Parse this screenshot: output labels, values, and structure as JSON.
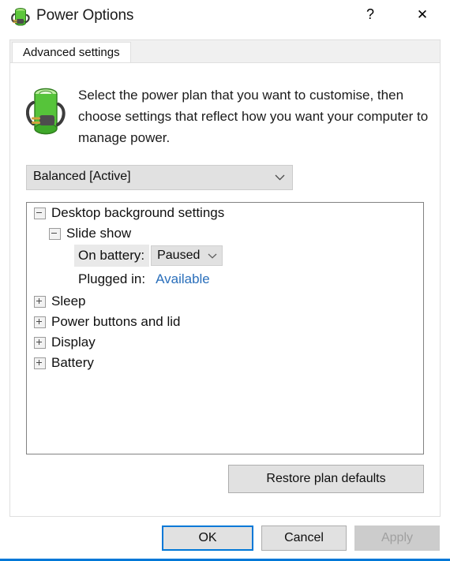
{
  "window": {
    "title": "Power Options",
    "icon": "power-plan-battery-plug-icon",
    "help_label": "?",
    "close_label": "✕",
    "accent_color": "#0078d7"
  },
  "tabs": [
    {
      "label": "Advanced settings",
      "selected": true
    }
  ],
  "header": {
    "icon": "battery-with-power-plug-icon",
    "description": "Select the power plan that you want to customise, then choose settings that reflect how you want your computer to manage power."
  },
  "plan_selector": {
    "name": "power-plan-dropdown",
    "selected": "Balanced [Active]",
    "arrow": "chevron-down-icon"
  },
  "settings_tree": {
    "nodes": [
      {
        "label": "Desktop background settings",
        "level": 0,
        "expanded": true,
        "expander": "collapse-minus-icon"
      },
      {
        "label": "Slide show",
        "level": 1,
        "expanded": true,
        "expander": "collapse-minus-icon"
      }
    ],
    "settings": [
      {
        "name": "On battery:",
        "highlighted": true,
        "control": "combobox",
        "value": "Paused",
        "arrow": "chevron-down-icon"
      },
      {
        "name": "Plugged in:",
        "highlighted": false,
        "control": "link",
        "value": "Available",
        "value_color": "#2a6fbb"
      }
    ],
    "collapsed_nodes": [
      {
        "label": "Sleep",
        "level": 0,
        "expander": "expand-plus-icon"
      },
      {
        "label": "Power buttons and lid",
        "level": 0,
        "expander": "expand-plus-icon"
      },
      {
        "label": "Display",
        "level": 0,
        "expander": "expand-plus-icon"
      },
      {
        "label": "Battery",
        "level": 0,
        "expander": "expand-plus-icon"
      }
    ]
  },
  "buttons": {
    "restore_defaults": "Restore plan defaults",
    "ok": "OK",
    "cancel": "Cancel",
    "apply": "Apply",
    "apply_enabled": false
  }
}
